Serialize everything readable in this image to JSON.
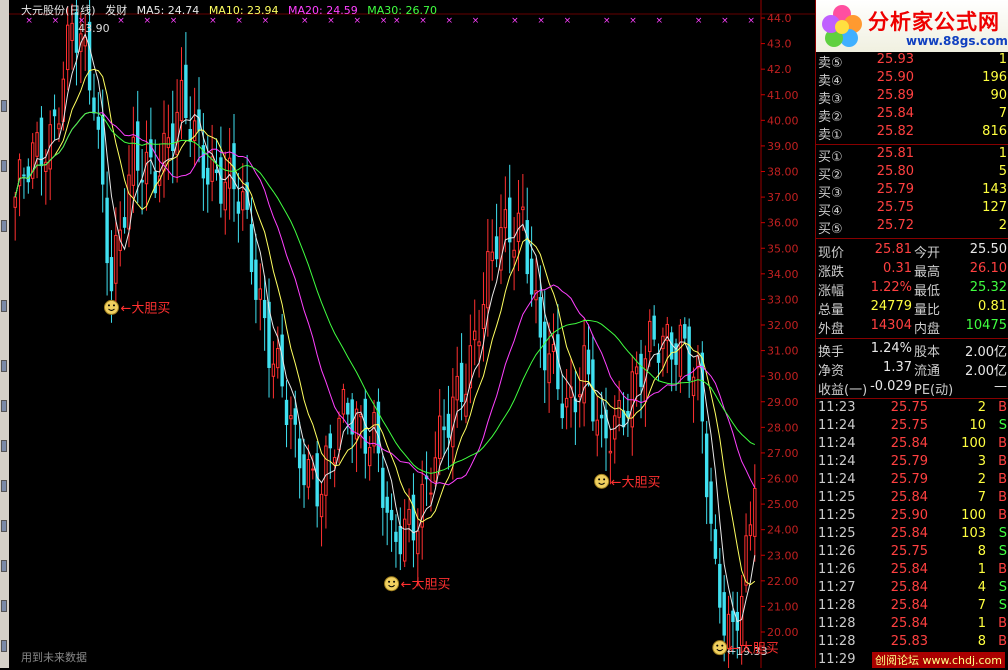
{
  "header": {
    "title": "大元股份(日线)",
    "formula": "发财",
    "ma5": "MA5: 24.74",
    "ma10": "MA10: 23.94",
    "ma20": "MA20: 24.59",
    "ma30": "MA30: 26.70"
  },
  "colors": {
    "up": "#ff3030",
    "down": "#40e0f0",
    "ma5": "#e8e8e8",
    "ma10": "#ffff60",
    "ma20": "#ff40ff",
    "ma30": "#40ff40",
    "label": "#ff3030"
  },
  "chart_data": {
    "type": "candlestick",
    "price_axis": {
      "labels": [
        "44.0",
        "43.0",
        "42.0",
        "41.00",
        "40.00",
        "39.00",
        "38.00",
        "37.00",
        "36.00",
        "35.00",
        "34.00",
        "33.00",
        "32.00",
        "31.00",
        "30.00",
        "29.00",
        "28.00",
        "27.00",
        "26.00",
        "25.00",
        "24.00",
        "23.00",
        "22.00",
        "21.00",
        "20.00"
      ]
    },
    "marks": {
      "high_label": "43.90",
      "low_label": "←19.33",
      "signal_text": "大胆买",
      "signal_icon": "smiley-icon"
    },
    "signals": [
      {
        "text": "大胆买",
        "bar": 22,
        "price": 33.0
      },
      {
        "text": "大胆买",
        "bar": 86,
        "price": 22.2
      },
      {
        "text": "大胆买",
        "bar": 134,
        "price": 26.2
      },
      {
        "text": "大胆买",
        "bar": 161,
        "price": 19.7
      }
    ]
  },
  "footer": {
    "note": "用到未来数据"
  },
  "logo": {
    "title": "分析家公式网",
    "url": "www.88gs.com"
  },
  "order_book": {
    "asks": [
      {
        "label": "卖⑤",
        "price": "25.93",
        "vol": "1"
      },
      {
        "label": "卖④",
        "price": "25.90",
        "vol": "196"
      },
      {
        "label": "卖③",
        "price": "25.89",
        "vol": "90"
      },
      {
        "label": "卖②",
        "price": "25.84",
        "vol": "7"
      },
      {
        "label": "卖①",
        "price": "25.82",
        "vol": "816"
      }
    ],
    "bids": [
      {
        "label": "买①",
        "price": "25.81",
        "vol": "1"
      },
      {
        "label": "买②",
        "price": "25.80",
        "vol": "5"
      },
      {
        "label": "买③",
        "price": "25.79",
        "vol": "143"
      },
      {
        "label": "买④",
        "price": "25.75",
        "vol": "127"
      },
      {
        "label": "买⑤",
        "price": "25.72",
        "vol": "2"
      }
    ]
  },
  "stats": [
    {
      "l1": "现价",
      "a1": "25.81",
      "c1": "red",
      "l2": "今开",
      "a2": "25.50",
      "c2": "white"
    },
    {
      "l1": "涨跌",
      "a1": "0.31",
      "c1": "red",
      "l2": "最高",
      "a2": "26.10",
      "c2": "red"
    },
    {
      "l1": "涨幅",
      "a1": "1.22%",
      "c1": "red",
      "l2": "最低",
      "a2": "25.32",
      "c2": "green"
    },
    {
      "l1": "总量",
      "a1": "24779",
      "c1": "yellow",
      "l2": "量比",
      "a2": "0.81",
      "c2": "yellow"
    },
    {
      "l1": "外盘",
      "a1": "14304",
      "c1": "red",
      "l2": "内盘",
      "a2": "10475",
      "c2": "green"
    }
  ],
  "stats2": [
    {
      "l1": "换手",
      "a1": "1.24%",
      "c1": "white",
      "l2": "股本",
      "a2": "2.00亿",
      "c2": "white"
    },
    {
      "l1": "净资",
      "a1": "1.37",
      "c1": "white",
      "l2": "流通",
      "a2": "2.00亿",
      "c2": "white"
    },
    {
      "l1": "收益(一)",
      "a1": "-0.029",
      "c1": "white",
      "l2": "PE(动)",
      "a2": "—",
      "c2": "white"
    }
  ],
  "ticks": [
    {
      "t": "11:23",
      "p": "25.75",
      "q": "2",
      "s": "B"
    },
    {
      "t": "11:24",
      "p": "25.75",
      "q": "10",
      "s": "S"
    },
    {
      "t": "11:24",
      "p": "25.84",
      "q": "100",
      "s": "B"
    },
    {
      "t": "11:24",
      "p": "25.79",
      "q": "3",
      "s": "B"
    },
    {
      "t": "11:24",
      "p": "25.79",
      "q": "2",
      "s": "B"
    },
    {
      "t": "11:25",
      "p": "25.84",
      "q": "7",
      "s": "B"
    },
    {
      "t": "11:25",
      "p": "25.90",
      "q": "100",
      "s": "B"
    },
    {
      "t": "11:25",
      "p": "25.84",
      "q": "103",
      "s": "S"
    },
    {
      "t": "11:26",
      "p": "25.75",
      "q": "8",
      "s": "S"
    },
    {
      "t": "11:26",
      "p": "25.84",
      "q": "1",
      "s": "B"
    },
    {
      "t": "11:27",
      "p": "25.84",
      "q": "4",
      "s": "S"
    },
    {
      "t": "11:28",
      "p": "25.84",
      "q": "7",
      "s": "S"
    },
    {
      "t": "11:28",
      "p": "25.84",
      "q": "1",
      "s": "B"
    },
    {
      "t": "11:28",
      "p": "25.83",
      "q": "8",
      "s": "B"
    },
    {
      "t": "11:29",
      "p": "25.81",
      "q": "",
      "s": ""
    }
  ],
  "watermark": "创阅论坛 www.chdj.com"
}
